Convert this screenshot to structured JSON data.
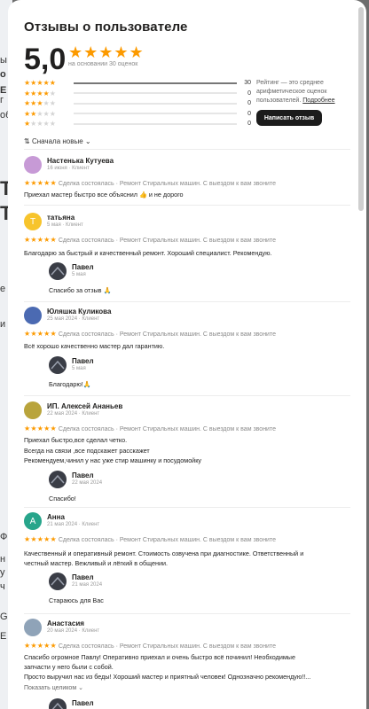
{
  "background_labels": [
    "ы",
    "о",
    "Е",
    "г",
    "об",
    "Т",
    "Т",
    "е",
    "и",
    "Ф",
    "н",
    "у",
    "ч",
    "G",
    "E"
  ],
  "header": {
    "title": "Отзывы о пользователе",
    "rating": "5,0",
    "stars": "★★★★★",
    "based_on": "на основании 30 оценок"
  },
  "distribution": [
    {
      "stars": 5,
      "count": "30",
      "fraction": 1.0
    },
    {
      "stars": 4,
      "count": "0",
      "fraction": 0
    },
    {
      "stars": 3,
      "count": "0",
      "fraction": 0
    },
    {
      "stars": 2,
      "count": "0",
      "fraction": 0
    },
    {
      "stars": 1,
      "count": "0",
      "fraction": 0
    }
  ],
  "rating_note": {
    "text": "Рейтинг — это среднее арифметическое оценок пользователей.",
    "link": "Подробнее"
  },
  "write_button": "Написать отзыв",
  "sort": {
    "icon": "sort-icon",
    "label": "Сначала новые"
  },
  "colors": {
    "star": "#fc9a00",
    "button": "#1c1c1c",
    "accent_avatar_yellow": "#f7c42c",
    "accent_avatar_teal": "#27a58b"
  },
  "reviews": [
    {
      "name": "Настенька Кутуева",
      "meta": "16 июня · Клиент",
      "stars": "★★★★★",
      "deal": "Сделка состоялась · Ремонт Стиральных машин. С выездом к вам звоните",
      "text": [
        "Приехал мастер быстро все объяснил 👍 и не дорого"
      ],
      "avatar": {
        "type": "photo",
        "color": "#c79ad6"
      }
    },
    {
      "name": "татьяна",
      "meta": "5 мая · Клиент",
      "stars": "★★★★★",
      "deal": "Сделка состоялась · Ремонт Стиральных машин. С выездом к вам звоните",
      "text": [
        "Благодарю за быстрый и качественный ремонт. Хороший специалист. Рекомендую."
      ],
      "avatar": {
        "type": "letter",
        "letter": "Т",
        "color": "#f7c42c"
      },
      "reply": {
        "name": "Павел",
        "date": "5 мая",
        "text": "Спасибо за отзыв 🙏"
      }
    },
    {
      "name": "Юляшка Куликова",
      "meta": "25 мая 2024 · Клиент",
      "stars": "★★★★★",
      "deal": "Сделка состоялась · Ремонт Стиральных машин. С выездом к вам звоните",
      "text": [
        "Всё хорошо качественно мастер дал гарантию."
      ],
      "avatar": {
        "type": "photo",
        "color": "#4b6ab2"
      },
      "reply": {
        "name": "Павел",
        "date": "5 мая",
        "text": "Благодарю!🙏"
      }
    },
    {
      "name": "ИП. Алексей Ананьев",
      "meta": "22 мая 2024 · Клиент",
      "stars": "★★★★★",
      "deal": "Сделка состоялась · Ремонт Стиральных машин. С выездом к вам звоните",
      "text": [
        "Приехал быстро,все сделал четко.",
        "Всегда на связи ,все подскажет расскажет",
        "Рекомендуем,чинил у нас уже стир машинку и посудомойку"
      ],
      "avatar": {
        "type": "photo",
        "color": "#b9a43c"
      },
      "reply": {
        "name": "Павел",
        "date": "22 мая 2024",
        "text": "Спасибо!"
      }
    },
    {
      "name": "Анна",
      "meta": "21 мая 2024 · Клиент",
      "stars": "★★★★★",
      "deal": "Сделка состоялась · Ремонт Стиральных машин. С выездом к вам звоните",
      "text": [
        "Качественный и оперативный ремонт. Стоимость озвучена при диагностике. Ответственный и",
        "честный мастер. Вежливый и лёгкий в общении."
      ],
      "avatar": {
        "type": "letter",
        "letter": "А",
        "color": "#27a58b"
      },
      "reply": {
        "name": "Павел",
        "date": "21 мая 2024",
        "text": "Стараюсь для Вас"
      }
    },
    {
      "name": "Анастасия",
      "meta": "20 мая 2024 · Клиент",
      "stars": "★★★★★",
      "deal": "Сделка состоялась · Ремонт Стиральных машин. С выездом к вам звоните",
      "text": [
        "Спасибо огромное Павлу! Оперативно приехал и очень быстро всё починил! Необходимые",
        "запчасти у него были с собой.",
        "Просто выручил нас из беды! Хороший мастер и приятный человек! Однозначно рекомендую!!..."
      ],
      "show_more": "Показать целиком",
      "avatar": {
        "type": "photo",
        "color": "#8fa3b8"
      },
      "reply": {
        "name": "Павел",
        "date": "",
        "text": ""
      }
    }
  ]
}
